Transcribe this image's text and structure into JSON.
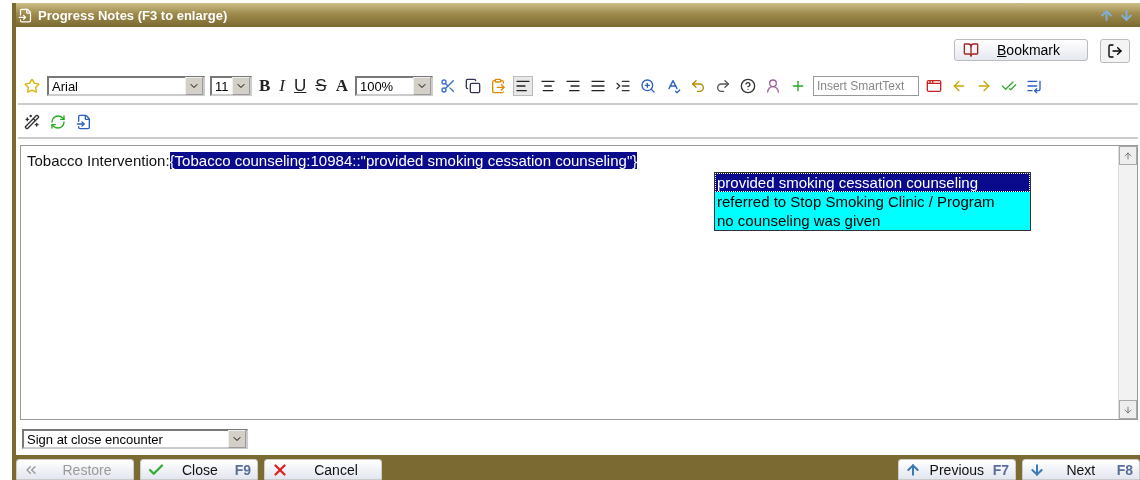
{
  "window": {
    "title": "Progress Notes (F3 to enlarge)"
  },
  "bookmark_button": "Bookmark",
  "toolbar": {
    "font": "Arial",
    "size": "11",
    "format_buttons": [
      {
        "label": "B",
        "kind": "bold"
      },
      {
        "label": "I",
        "kind": "italic"
      },
      {
        "label": "U",
        "kind": "underline"
      },
      {
        "label": "S",
        "kind": "strike"
      },
      {
        "label": "A",
        "kind": "color"
      }
    ],
    "zoom": "100%",
    "align_buttons": [
      {
        "selected": true
      },
      {
        "selected": false
      },
      {
        "selected": false
      },
      {
        "selected": false
      }
    ],
    "smarttext": {
      "placeholder": "Insert SmartText"
    }
  },
  "editor": {
    "label": "Tobacco Intervention:",
    "field": "{Tobacco counseling:10984::\"provided smoking cessation counseling\"}",
    "options": [
      {
        "label": "provided smoking cessation counseling",
        "selected": true
      },
      {
        "label": "referred to Stop Smoking Clinic / Program",
        "selected": false
      },
      {
        "label": "no counseling was given",
        "selected": false
      }
    ]
  },
  "sign_select": "Sign at close encounter",
  "left_buttons": [
    {
      "label": "Restore",
      "kind": "restore",
      "disabled": true
    },
    {
      "label": "Close",
      "kind": "close",
      "shortcut": "F9",
      "disabled": false
    },
    {
      "label": "Cancel",
      "kind": "cancel",
      "disabled": false
    }
  ],
  "right_buttons": [
    {
      "label": "Previous",
      "kind": "previous",
      "shortcut": "F7",
      "disabled": false
    },
    {
      "label": "Next",
      "kind": "next",
      "shortcut": "F8",
      "disabled": false
    }
  ]
}
